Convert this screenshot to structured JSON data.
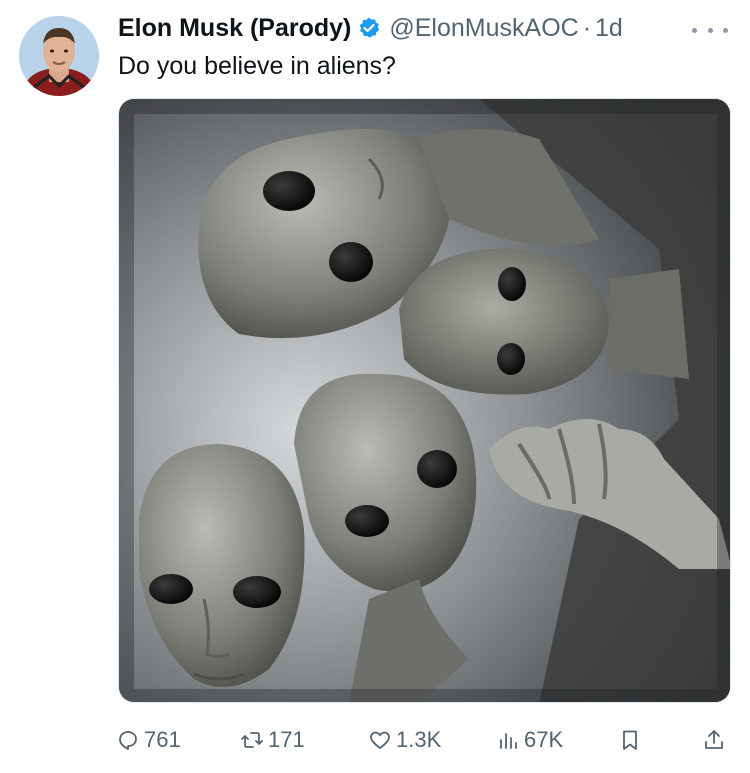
{
  "tweet": {
    "author_name": "Elon Musk (Parody)",
    "handle": "@ElonMuskAOC",
    "separator": "·",
    "time": "1d",
    "text": "Do you believe in aliens?",
    "verified_color": "#1d9bf0"
  },
  "actions": {
    "replies": "761",
    "retweets": "171",
    "likes": "1.3K",
    "views": "67K"
  },
  "icons": [
    "reply-icon",
    "retweet-icon",
    "like-icon",
    "views-icon",
    "bookmark-icon",
    "share-icon",
    "more-icon",
    "verified-badge-icon"
  ]
}
